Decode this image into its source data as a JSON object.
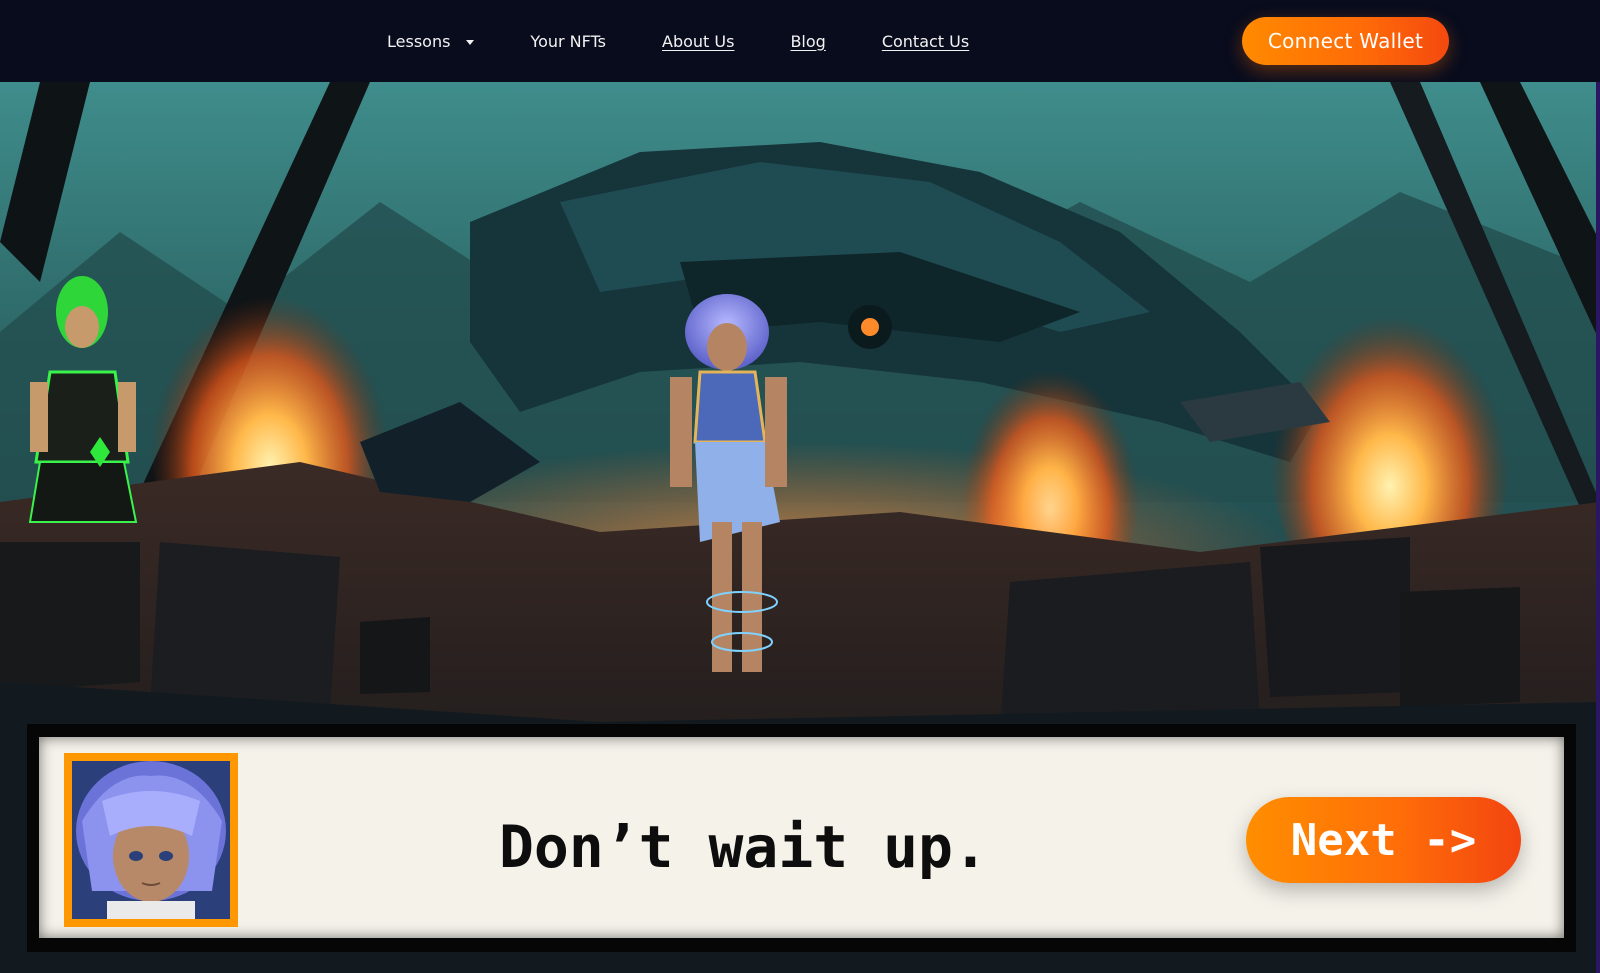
{
  "nav": {
    "links": [
      {
        "label": "Lessons",
        "dropdown": true
      },
      {
        "label": "Your NFTs"
      },
      {
        "label": "About Us"
      },
      {
        "label": "Blog"
      },
      {
        "label": "Contact Us"
      }
    ],
    "connect_wallet_label": "Connect Wallet"
  },
  "dialogue": {
    "text": "Don’t wait up.",
    "next_label": "Next ->"
  },
  "colors": {
    "nav_bg": "#080c1d",
    "accent_orange": "#ff7a00",
    "dialog_bg": "#f5f2ea",
    "portrait_border": "#ff9800"
  },
  "icons": {
    "lessons_dropdown": "caret-down-icon"
  }
}
